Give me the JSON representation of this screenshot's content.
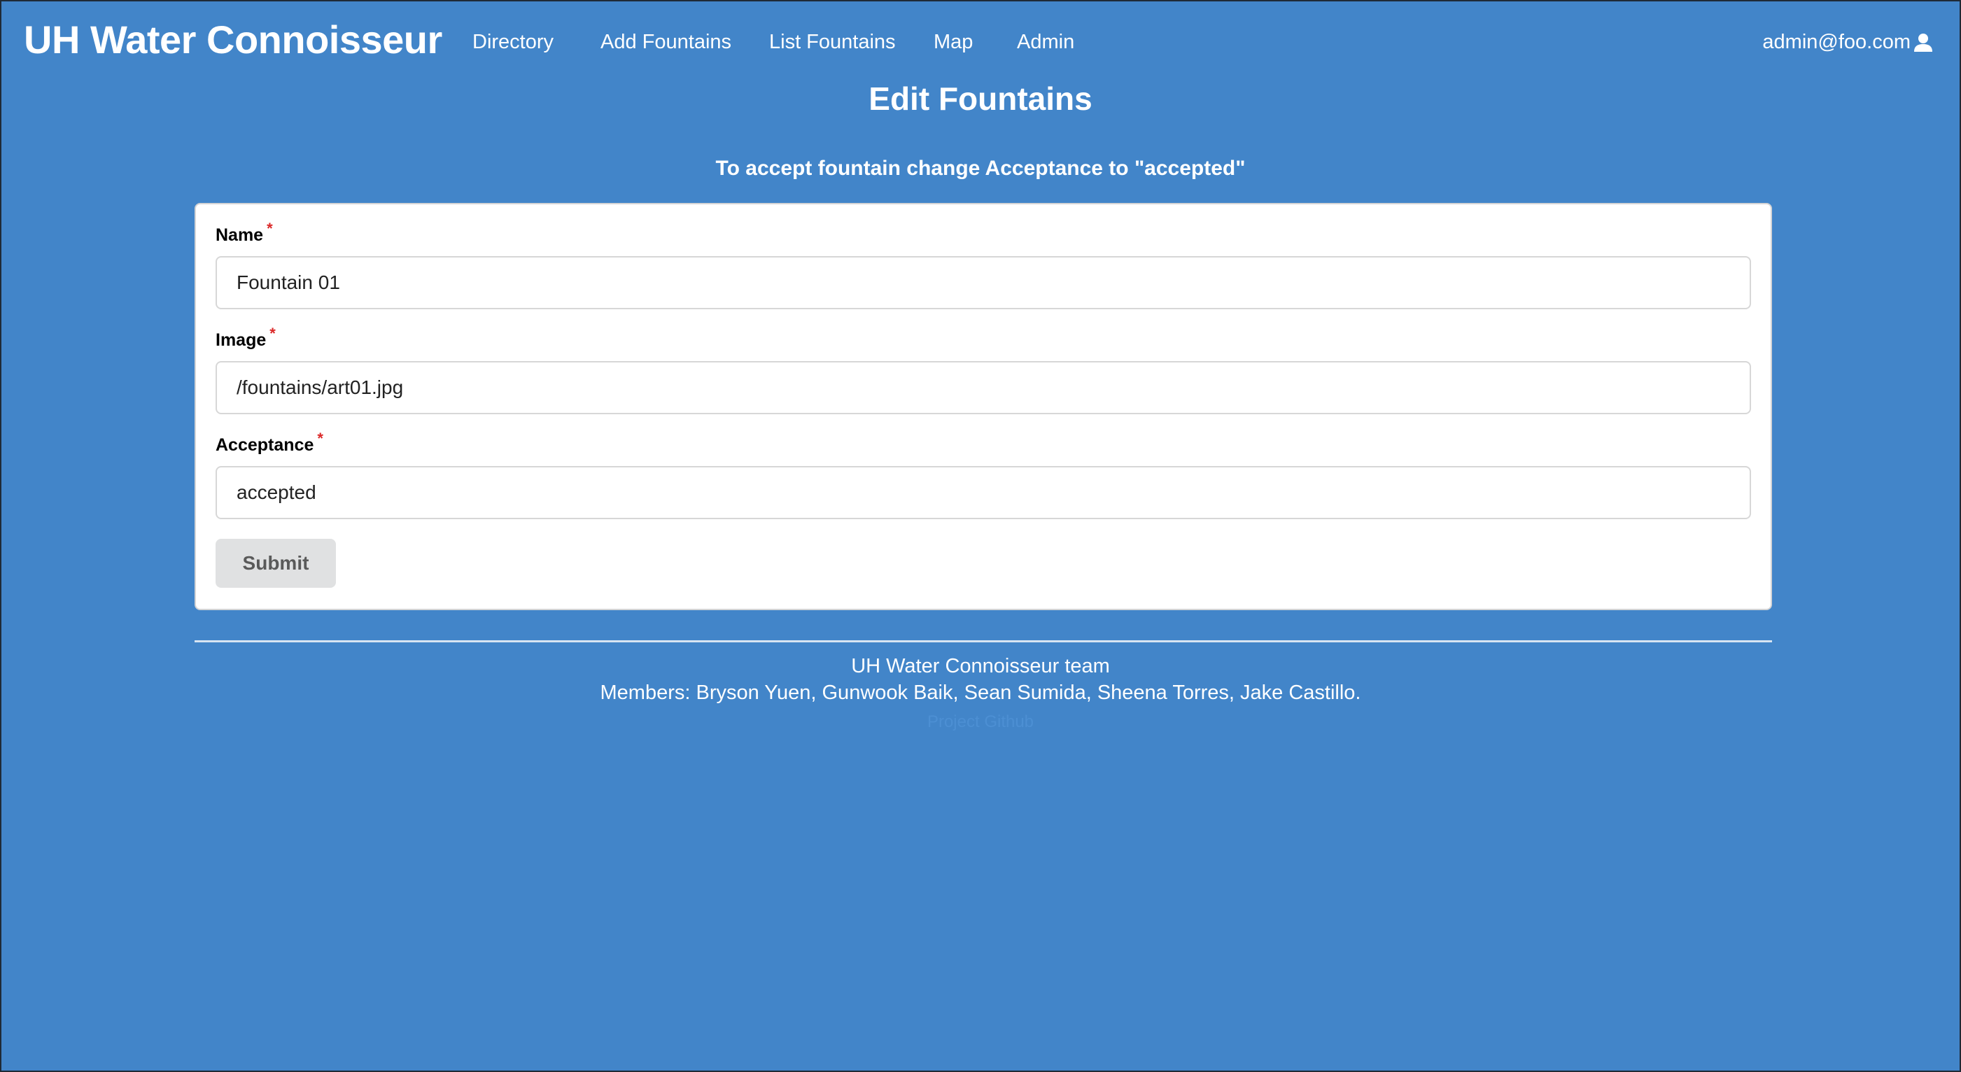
{
  "navbar": {
    "brand": "UH Water Connoisseur",
    "items": [
      {
        "label": "Directory"
      },
      {
        "label": "Add Fountains"
      },
      {
        "label": "List Fountains"
      },
      {
        "label": "Map"
      },
      {
        "label": "Admin"
      }
    ],
    "user_email": "admin@foo.com",
    "user_icon": "user-icon"
  },
  "page": {
    "title": "Edit Fountains",
    "instruction": "To accept fountain change Acceptance to \"accepted\""
  },
  "form": {
    "fields": [
      {
        "label": "Name",
        "required_marker": "*",
        "value": "Fountain 01"
      },
      {
        "label": "Image",
        "required_marker": "*",
        "value": "/fountains/art01.jpg"
      },
      {
        "label": "Acceptance",
        "required_marker": "*",
        "value": "accepted"
      }
    ],
    "submit_label": "Submit"
  },
  "footer": {
    "team": "UH Water Connoisseur team",
    "members": "Members: Bryson Yuen, Gunwook Baik, Sean Sumida, Sheena Torres, Jake Castillo.",
    "link": "Project Github"
  },
  "colors": {
    "background": "#4285c9",
    "required": "#db2828",
    "button_bg": "#e0e1e2"
  }
}
